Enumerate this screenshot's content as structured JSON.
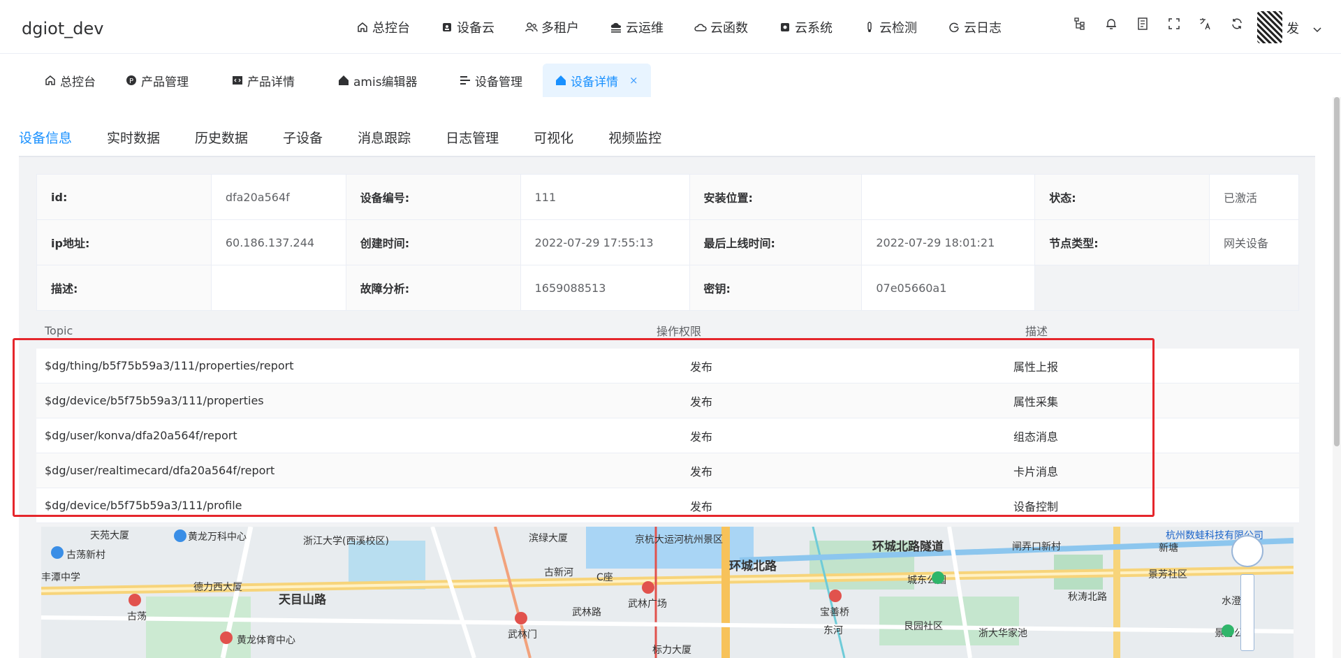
{
  "app": {
    "title": "dgiot_dev",
    "user": "发"
  },
  "topnav": [
    {
      "label": "总控台",
      "icon": "home-icon"
    },
    {
      "label": "设备云",
      "icon": "device-icon"
    },
    {
      "label": "多租户",
      "icon": "users-icon"
    },
    {
      "label": "云运维",
      "icon": "cloud-ops-icon"
    },
    {
      "label": "云函数",
      "icon": "cloud-icon"
    },
    {
      "label": "云系统",
      "icon": "gear-icon"
    },
    {
      "label": "云检测",
      "icon": "probe-icon"
    },
    {
      "label": "云日志",
      "icon": "log-icon"
    }
  ],
  "tags": [
    {
      "label": "总控台",
      "icon": "home-icon"
    },
    {
      "label": "产品管理",
      "icon": "product-icon"
    },
    {
      "label": "产品详情",
      "icon": "code-icon"
    },
    {
      "label": "amis编辑器",
      "icon": "house-icon"
    },
    {
      "label": "设备管理",
      "icon": "list-icon"
    },
    {
      "label": "设备详情",
      "icon": "house-icon",
      "close": "×"
    }
  ],
  "tabs": [
    "设备信息",
    "实时数据",
    "历史数据",
    "子设备",
    "消息跟踪",
    "日志管理",
    "可视化",
    "视频监控"
  ],
  "desc": [
    [
      [
        "id:",
        "dfa20a564f"
      ],
      [
        "设备编号:",
        "111"
      ],
      [
        "安装位置:",
        ""
      ],
      [
        "状态:",
        "已激活"
      ]
    ],
    [
      [
        "ip地址:",
        "60.186.137.244"
      ],
      [
        "创建时间:",
        "2022-07-29 17:55:13"
      ],
      [
        "最后上线时间:",
        "2022-07-29 18:01:21"
      ],
      [
        "节点类型:",
        "网关设备"
      ]
    ],
    [
      [
        "描述:",
        ""
      ],
      [
        "故障分析:",
        "1659088513"
      ],
      [
        "密钥:",
        "07e05660a1"
      ]
    ]
  ],
  "topic": {
    "headers": [
      "Topic",
      "操作权限",
      "描述"
    ],
    "rows": [
      [
        "$dg/thing/b5f75b59a3/111/properties/report",
        "发布",
        "属性上报"
      ],
      [
        "$dg/device/b5f75b59a3/111/properties",
        "发布",
        "属性采集"
      ],
      [
        "$dg/user/konva/dfa20a564f/report",
        "发布",
        "组态消息"
      ],
      [
        "$dg/user/realtimecard/dfa20a564f/report",
        "发布",
        "卡片消息"
      ],
      [
        "$dg/device/b5f75b59a3/111/profile",
        "发布",
        "设备控制"
      ]
    ]
  },
  "map": {
    "labels": [
      "天苑大厦",
      "黄龙万科中心",
      "浙江大学(西溪校区)",
      "滨绿大厦",
      "京杭大运河杭州景区",
      "环城北路",
      "环城北路隧道",
      "闸弄口新村",
      "杭州数蛙科技有限公司",
      "新塘",
      "古荡新村",
      "德力西大厦",
      "天目山路",
      "古荡",
      "黄龙体育中心",
      "武林门",
      "武林广场",
      "C座",
      "宝善桥",
      "城东公园",
      "艮园社区",
      "浙大华家池",
      "景芳社区",
      "秋涛北路",
      "水澄苑",
      "景芳公园",
      "丰潭中学",
      "古新河",
      "武林路",
      "东河",
      "标力大厦"
    ]
  }
}
